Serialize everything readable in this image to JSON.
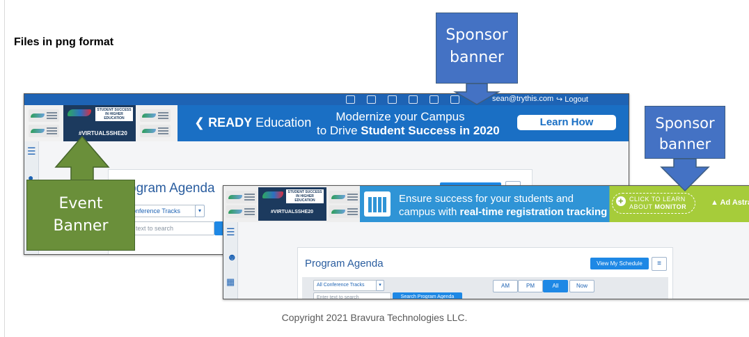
{
  "heading": "Files in png format",
  "copyright": "Copyright 2021 Bravura Technologies LLC.",
  "callouts": {
    "sponsor_top": {
      "line1": "Sponsor",
      "line2": "banner"
    },
    "sponsor_right": {
      "line1": "Sponsor",
      "line2": "banner"
    },
    "event": {
      "line1": "Event",
      "line2": "Banner"
    }
  },
  "screenshot_back": {
    "user_email": "sean@trythis.com",
    "logout": "Logout",
    "event_tag": "#VIRTUALSSHE20",
    "event_box": "STUDENT SUCCESS IN HIGHER EDUCATION",
    "ready_brand": "READY",
    "ready_brand_suffix": "Education",
    "ready_line1": "Modernize your Campus",
    "ready_line2_prefix": "to Drive ",
    "ready_line2_bold": "Student Success in 2020",
    "ready_cta": "Learn How",
    "agenda_title": "Program Agenda",
    "tracks_select": "All Conference Tracks",
    "search_placeholder": "Enter text to search"
  },
  "screenshot_front": {
    "event_tag": "#VIRTUALSSHE20",
    "event_box": "STUDENT SUCCESS IN HIGHER EDUCATION",
    "sponsor_line1": "Ensure success for your students and",
    "sponsor_line2_prefix": "campus with ",
    "sponsor_line2_bold": "real-time registration tracking",
    "cta_line1": "CLICK TO LEARN",
    "cta_line2_prefix": "ABOUT ",
    "cta_line2_bold": "MONITOR",
    "brand": "Ad Astra",
    "agenda_title": "Program Agenda",
    "view_schedule": "View My Schedule",
    "tracks_select": "All Conference Tracks",
    "search_placeholder": "Enter text to search",
    "search_button": "Search Program Agenda",
    "time_filters": [
      "AM",
      "PM",
      "All",
      "Now"
    ],
    "active_filter": "All"
  }
}
